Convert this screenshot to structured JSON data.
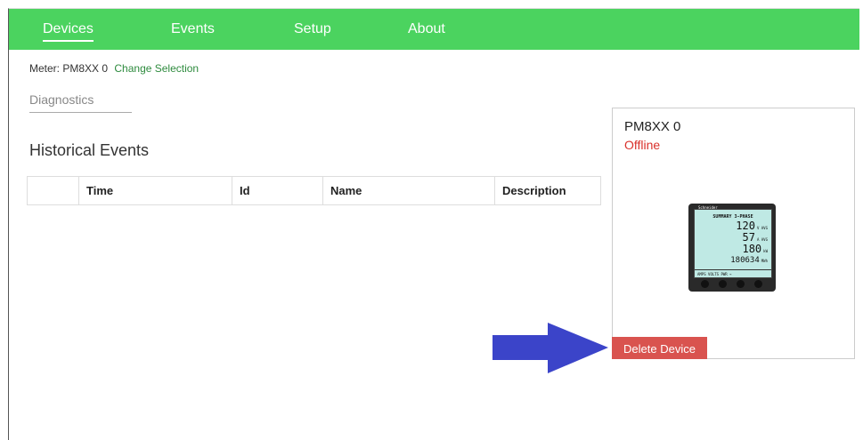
{
  "nav": {
    "items": [
      {
        "label": "Devices",
        "active": true
      },
      {
        "label": "Events",
        "active": false
      },
      {
        "label": "Setup",
        "active": false
      },
      {
        "label": "About",
        "active": false
      }
    ],
    "color": "#4bd35f"
  },
  "meter_line": {
    "prefix": "Meter: PM8XX 0",
    "link": "Change Selection"
  },
  "tabs": {
    "diagnostics": "Diagnostics"
  },
  "section": {
    "title": "Historical Events"
  },
  "table": {
    "columns": [
      "",
      "Time",
      "Id",
      "Name",
      "Description"
    ]
  },
  "device": {
    "name": "PM8XX 0",
    "status": "Offline",
    "status_color": "#d9312b",
    "meter_display": {
      "brand": "Schneider",
      "header": "SUMMARY 3-PHASE",
      "rows": [
        {
          "value": "120",
          "unit": "V AVG"
        },
        {
          "value": "57",
          "unit": "A AVG"
        },
        {
          "value": "180",
          "unit": "kW"
        },
        {
          "value": "180634",
          "unit": "MWh"
        }
      ],
      "footer": "AMPS VOLTS PWR →"
    },
    "delete_label": "Delete Device",
    "delete_color": "#d9534f"
  },
  "annotation": {
    "arrow_color": "#3b44c9"
  }
}
